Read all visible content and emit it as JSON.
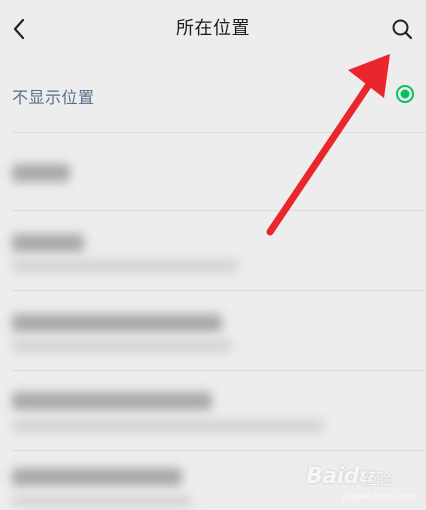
{
  "header": {
    "title": "所在位置",
    "back_icon": "chevron-left-icon",
    "search_icon": "search-icon"
  },
  "hide_location": {
    "label": "不显示位置",
    "selected": true,
    "accent_color": "#07c160"
  },
  "annotation": {
    "arrow_color": "#e8262b"
  },
  "watermark": {
    "brand": "Baidu",
    "sub": "经验",
    "url": "jingyan.baidu.com"
  }
}
